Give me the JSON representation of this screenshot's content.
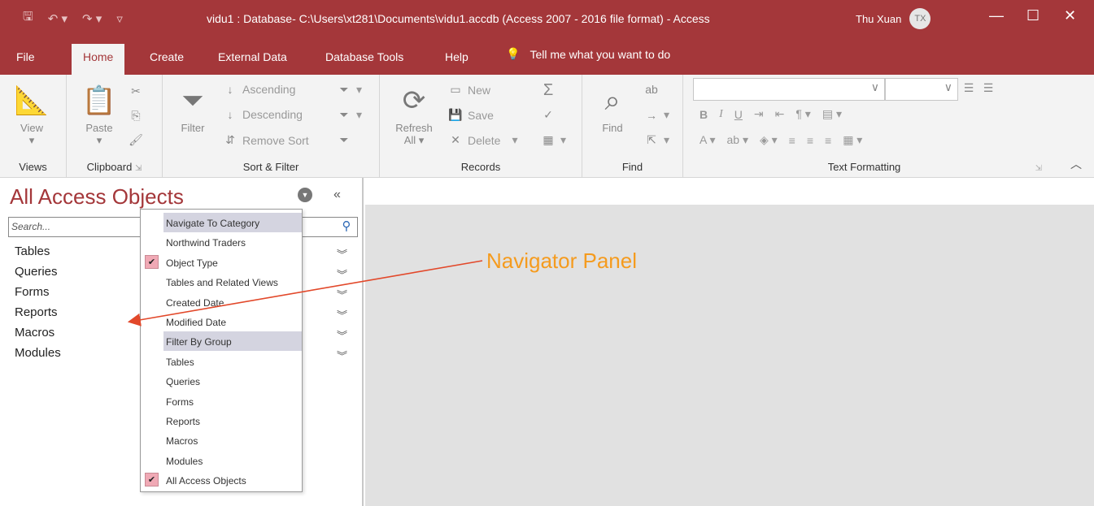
{
  "titlebar": {
    "title": "vidu1 : Database- C:\\Users\\xt281\\Documents\\vidu1.accdb (Access 2007 - 2016 file format)  -  Access",
    "user_name": "Thu Xuan",
    "user_initials": "TX"
  },
  "tabs": [
    "File",
    "Home",
    "Create",
    "External Data",
    "Database Tools",
    "Help"
  ],
  "tell_me": "Tell me what you want to do",
  "ribbon": {
    "views": {
      "label": "Views",
      "view": "View"
    },
    "clipboard": {
      "label": "Clipboard",
      "paste": "Paste"
    },
    "sort_filter": {
      "label": "Sort & Filter",
      "filter": "Filter",
      "ascending": "Ascending",
      "descending": "Descending",
      "remove_sort": "Remove Sort"
    },
    "records": {
      "label": "Records",
      "refresh": "Refresh",
      "refresh_all": "All",
      "new": "New",
      "save": "Save",
      "delete": "Delete"
    },
    "find": {
      "label": "Find",
      "find": "Find"
    },
    "text_formatting": {
      "label": "Text Formatting"
    }
  },
  "nav": {
    "title": "All Access Objects",
    "search_placeholder": "Search...",
    "categories": [
      "Tables",
      "Queries",
      "Forms",
      "Reports",
      "Macros",
      "Modules"
    ]
  },
  "dropdown": {
    "items": [
      {
        "label": "Navigate To Category",
        "header": true,
        "checked": false
      },
      {
        "label": "Northwind Traders",
        "header": false,
        "checked": false
      },
      {
        "label": "Object Type",
        "header": false,
        "checked": true
      },
      {
        "label": "Tables and Related Views",
        "header": false,
        "checked": false
      },
      {
        "label": "Created Date",
        "header": false,
        "checked": false
      },
      {
        "label": "Modified Date",
        "header": false,
        "checked": false
      },
      {
        "label": "Filter By Group",
        "header": true,
        "checked": false
      },
      {
        "label": "Tables",
        "header": false,
        "checked": false
      },
      {
        "label": "Queries",
        "header": false,
        "checked": false
      },
      {
        "label": "Forms",
        "header": false,
        "checked": false
      },
      {
        "label": "Reports",
        "header": false,
        "checked": false
      },
      {
        "label": "Macros",
        "header": false,
        "checked": false
      },
      {
        "label": "Modules",
        "header": false,
        "checked": false
      },
      {
        "label": "All Access Objects",
        "header": false,
        "checked": true
      }
    ]
  },
  "annotation": {
    "text": "Navigator Panel",
    "color": "#f59b1e",
    "arrow_color": "#e2482a"
  },
  "colors": {
    "accent": "#a4373a",
    "check": "#f0a9b5",
    "header_highlight": "#d4d4e0"
  }
}
